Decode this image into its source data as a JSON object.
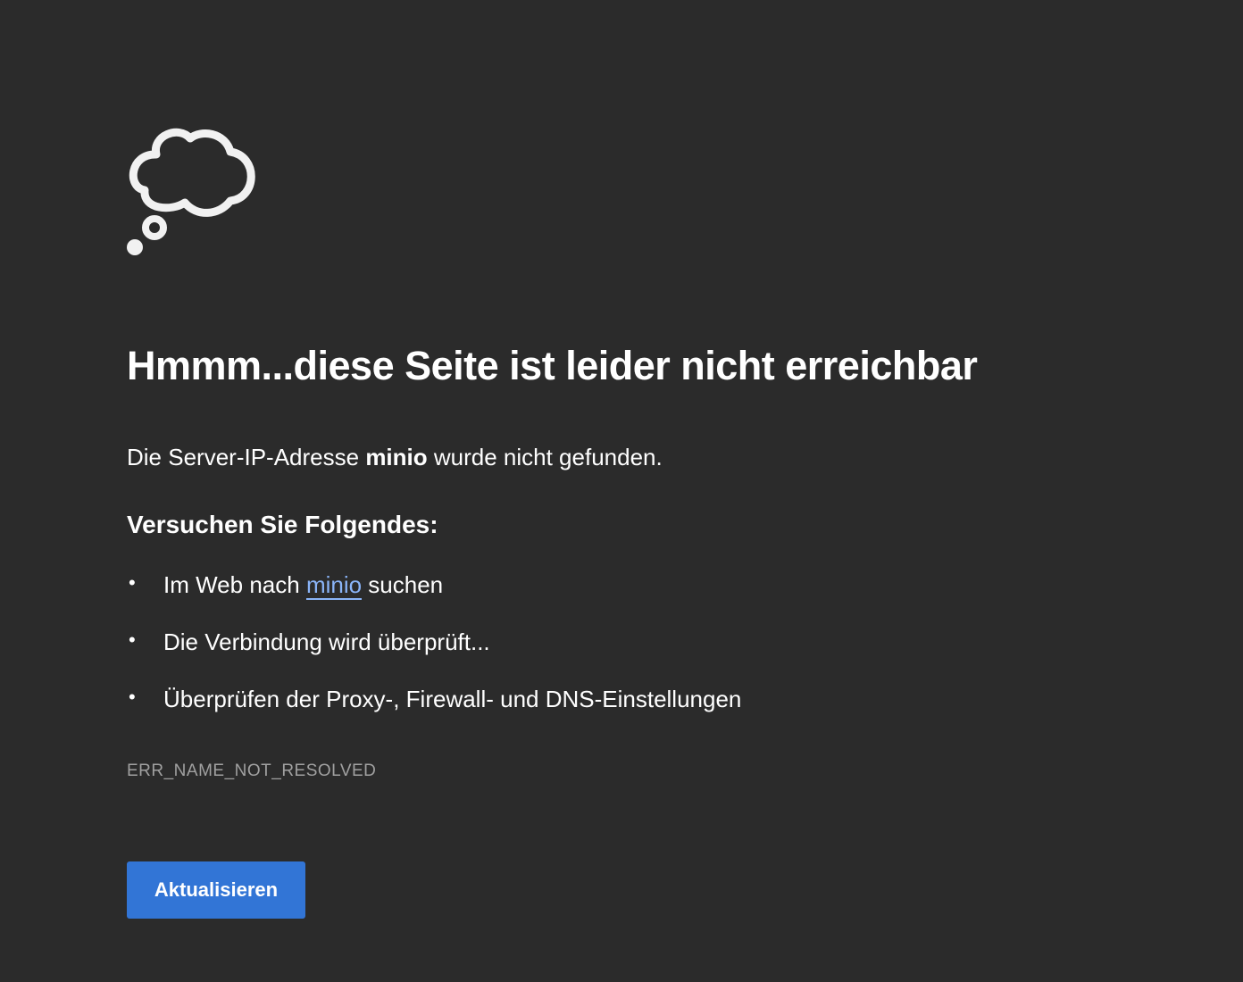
{
  "icon": "thought-bubble-icon",
  "title": "Hmmm...diese Seite ist leider nicht erreichbar",
  "description": {
    "prefix": "Die Server-IP-Adresse ",
    "host": "minio",
    "suffix": " wurde nicht gefunden."
  },
  "suggestions_heading": "Versuchen Sie Folgendes:",
  "suggestions": [
    {
      "prefix": "Im Web nach ",
      "link": "minio",
      "suffix": " suchen"
    },
    {
      "text": "Die Verbindung wird überprüft..."
    },
    {
      "text": "Überprüfen der Proxy-, Firewall- und DNS-Einstellungen"
    }
  ],
  "error_code": "ERR_NAME_NOT_RESOLVED",
  "reload_button": "Aktualisieren",
  "colors": {
    "background": "#2b2b2b",
    "text": "#ffffff",
    "link": "#8ab4f8",
    "error_code": "#a0a0a0",
    "button": "#3275d6"
  }
}
